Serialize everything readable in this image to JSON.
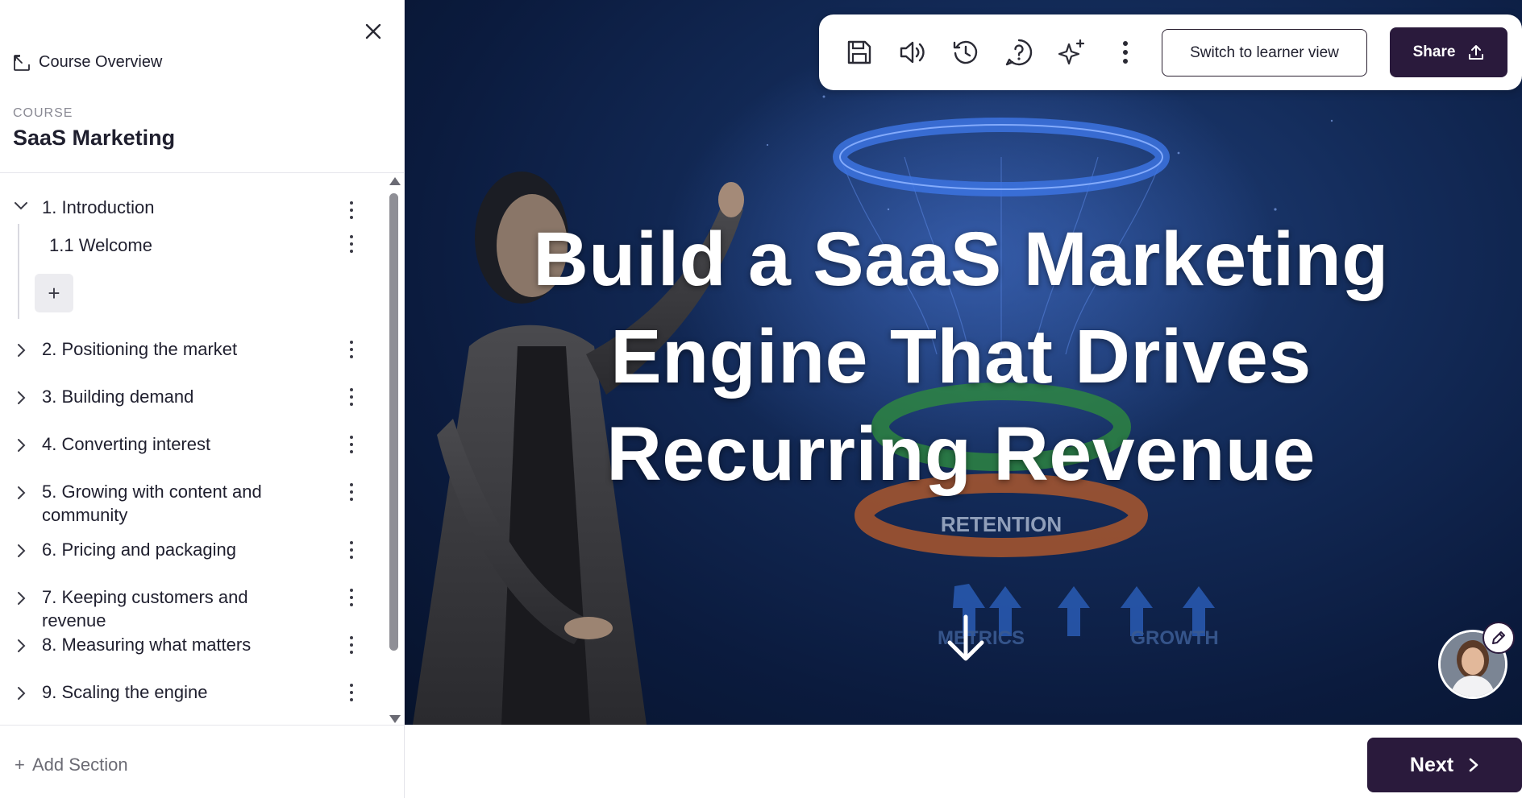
{
  "sidebar": {
    "overview_label": "Course Overview",
    "course_kicker": "COURSE",
    "course_title": "SaaS Marketing",
    "sections": [
      {
        "label": "1. Introduction",
        "expanded": true
      },
      {
        "label": "2. Positioning the market",
        "expanded": false
      },
      {
        "label": "3. Building demand",
        "expanded": false
      },
      {
        "label": "4. Converting interest",
        "expanded": false
      },
      {
        "label": "5. Growing with content and community",
        "expanded": false
      },
      {
        "label": "6. Pricing and packaging",
        "expanded": false
      },
      {
        "label": "7. Keeping customers and revenue",
        "expanded": false
      },
      {
        "label": "8. Measuring what matters",
        "expanded": false
      },
      {
        "label": "9. Scaling the engine",
        "expanded": false
      }
    ],
    "lessons": [
      {
        "label": "1.1 Welcome"
      }
    ],
    "add_lesson_label": "+",
    "add_section_label": "Add Section",
    "add_section_icon": "+"
  },
  "toolbar": {
    "icons": [
      "save-icon",
      "audio-icon",
      "history-icon",
      "help-icon",
      "sparkle-ai-icon",
      "more-vertical-icon"
    ],
    "learner_view_label": "Switch to learner view",
    "share_label": "Share"
  },
  "hero": {
    "title_lines": [
      "Build a SaaS Marketing",
      "Engine That Drives",
      "Recurring Revenue"
    ],
    "art_labels": {
      "retention": "RETENTION",
      "metrics": "METRICS",
      "growth": "GROWTH"
    }
  },
  "footer": {
    "next_label": "Next"
  },
  "colors": {
    "primary": "#2a1a3c",
    "hero_bg": "#0b1b3e"
  }
}
